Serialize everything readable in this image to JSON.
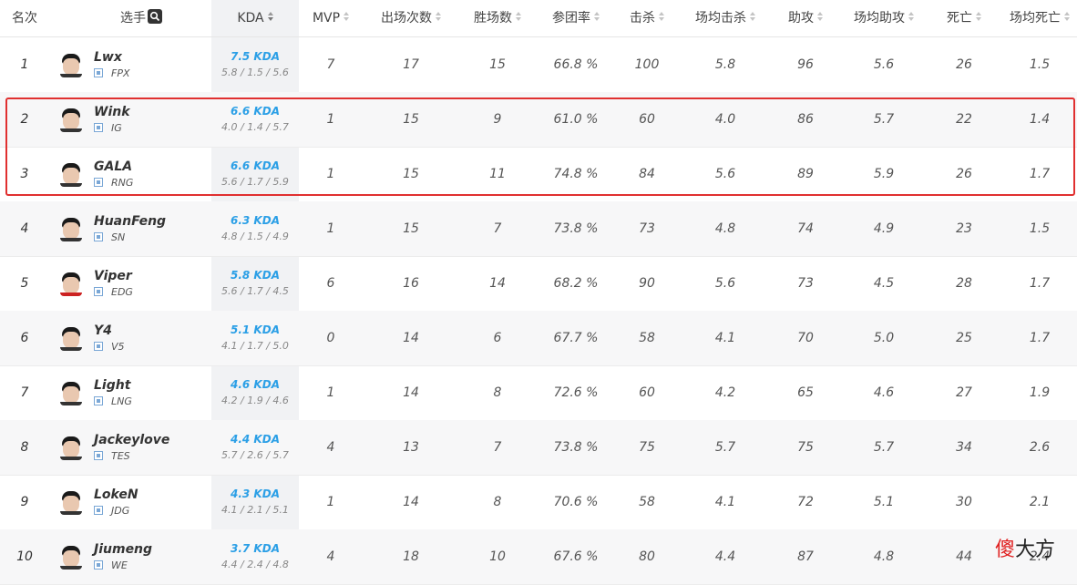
{
  "header": {
    "rank": "名次",
    "player": "选手",
    "kda": "KDA",
    "mvp": "MVP",
    "games": "出场次数",
    "wins": "胜场数",
    "participation": "参团率",
    "kills": "击杀",
    "avg_kills": "场均击杀",
    "assists": "助攻",
    "avg_assists": "场均助攻",
    "deaths": "死亡",
    "avg_deaths": "场均死亡"
  },
  "rows": [
    {
      "rank": "1",
      "name": "Lwx",
      "team": "FPX",
      "kda": "7.5 KDA",
      "kda_detail": "5.8 / 1.5 / 5.6",
      "mvp": "7",
      "games": "17",
      "wins": "15",
      "participation": "66.8 %",
      "kills": "100",
      "avg_kills": "5.8",
      "assists": "96",
      "avg_assists": "5.6",
      "deaths": "26",
      "avg_deaths": "1.5"
    },
    {
      "rank": "2",
      "name": "Wink",
      "team": "IG",
      "kda": "6.6 KDA",
      "kda_detail": "4.0 / 1.4 / 5.7",
      "mvp": "1",
      "games": "15",
      "wins": "9",
      "participation": "61.0 %",
      "kills": "60",
      "avg_kills": "4.0",
      "assists": "86",
      "avg_assists": "5.7",
      "deaths": "22",
      "avg_deaths": "1.4"
    },
    {
      "rank": "3",
      "name": "GALA",
      "team": "RNG",
      "kda": "6.6 KDA",
      "kda_detail": "5.6 / 1.7 / 5.9",
      "mvp": "1",
      "games": "15",
      "wins": "11",
      "participation": "74.8 %",
      "kills": "84",
      "avg_kills": "5.6",
      "assists": "89",
      "avg_assists": "5.9",
      "deaths": "26",
      "avg_deaths": "1.7"
    },
    {
      "rank": "4",
      "name": "HuanFeng",
      "team": "SN",
      "kda": "6.3 KDA",
      "kda_detail": "4.8 / 1.5 / 4.9",
      "mvp": "1",
      "games": "15",
      "wins": "7",
      "participation": "73.8 %",
      "kills": "73",
      "avg_kills": "4.8",
      "assists": "74",
      "avg_assists": "4.9",
      "deaths": "23",
      "avg_deaths": "1.5"
    },
    {
      "rank": "5",
      "name": "Viper",
      "team": "EDG",
      "kda": "5.8 KDA",
      "kda_detail": "5.6 / 1.7 / 4.5",
      "mvp": "6",
      "games": "16",
      "wins": "14",
      "participation": "68.2 %",
      "kills": "90",
      "avg_kills": "5.6",
      "assists": "73",
      "avg_assists": "4.5",
      "deaths": "28",
      "avg_deaths": "1.7"
    },
    {
      "rank": "6",
      "name": "Y4",
      "team": "V5",
      "kda": "5.1 KDA",
      "kda_detail": "4.1 / 1.7 / 5.0",
      "mvp": "0",
      "games": "14",
      "wins": "6",
      "participation": "67.7 %",
      "kills": "58",
      "avg_kills": "4.1",
      "assists": "70",
      "avg_assists": "5.0",
      "deaths": "25",
      "avg_deaths": "1.7"
    },
    {
      "rank": "7",
      "name": "Light",
      "team": "LNG",
      "kda": "4.6 KDA",
      "kda_detail": "4.2 / 1.9 / 4.6",
      "mvp": "1",
      "games": "14",
      "wins": "8",
      "participation": "72.6 %",
      "kills": "60",
      "avg_kills": "4.2",
      "assists": "65",
      "avg_assists": "4.6",
      "deaths": "27",
      "avg_deaths": "1.9"
    },
    {
      "rank": "8",
      "name": "Jackeylove",
      "team": "TES",
      "kda": "4.4 KDA",
      "kda_detail": "5.7 / 2.6 / 5.7",
      "mvp": "4",
      "games": "13",
      "wins": "7",
      "participation": "73.8 %",
      "kills": "75",
      "avg_kills": "5.7",
      "assists": "75",
      "avg_assists": "5.7",
      "deaths": "34",
      "avg_deaths": "2.6"
    },
    {
      "rank": "9",
      "name": "LokeN",
      "team": "JDG",
      "kda": "4.3 KDA",
      "kda_detail": "4.1 / 2.1 / 5.1",
      "mvp": "1",
      "games": "14",
      "wins": "8",
      "participation": "70.6 %",
      "kills": "58",
      "avg_kills": "4.1",
      "assists": "72",
      "avg_assists": "5.1",
      "deaths": "30",
      "avg_deaths": "2.1"
    },
    {
      "rank": "10",
      "name": "Jiumeng",
      "team": "WE",
      "kda": "3.7 KDA",
      "kda_detail": "4.4 / 2.4 / 4.8",
      "mvp": "4",
      "games": "18",
      "wins": "10",
      "participation": "67.6 %",
      "kills": "80",
      "avg_kills": "4.4",
      "assists": "87",
      "avg_assists": "4.8",
      "deaths": "44",
      "avg_deaths": "2.4"
    }
  ],
  "watermark": {
    "part1": "傻",
    "part2": "大方"
  },
  "colors": {
    "kda_accent": "#2b9fe6",
    "highlight": "#e03030",
    "kda_column_bg": "#f1f2f4"
  },
  "icons": {
    "player_search": "search-icon",
    "team": "team-logo-icon",
    "sort": "sort-icon"
  }
}
